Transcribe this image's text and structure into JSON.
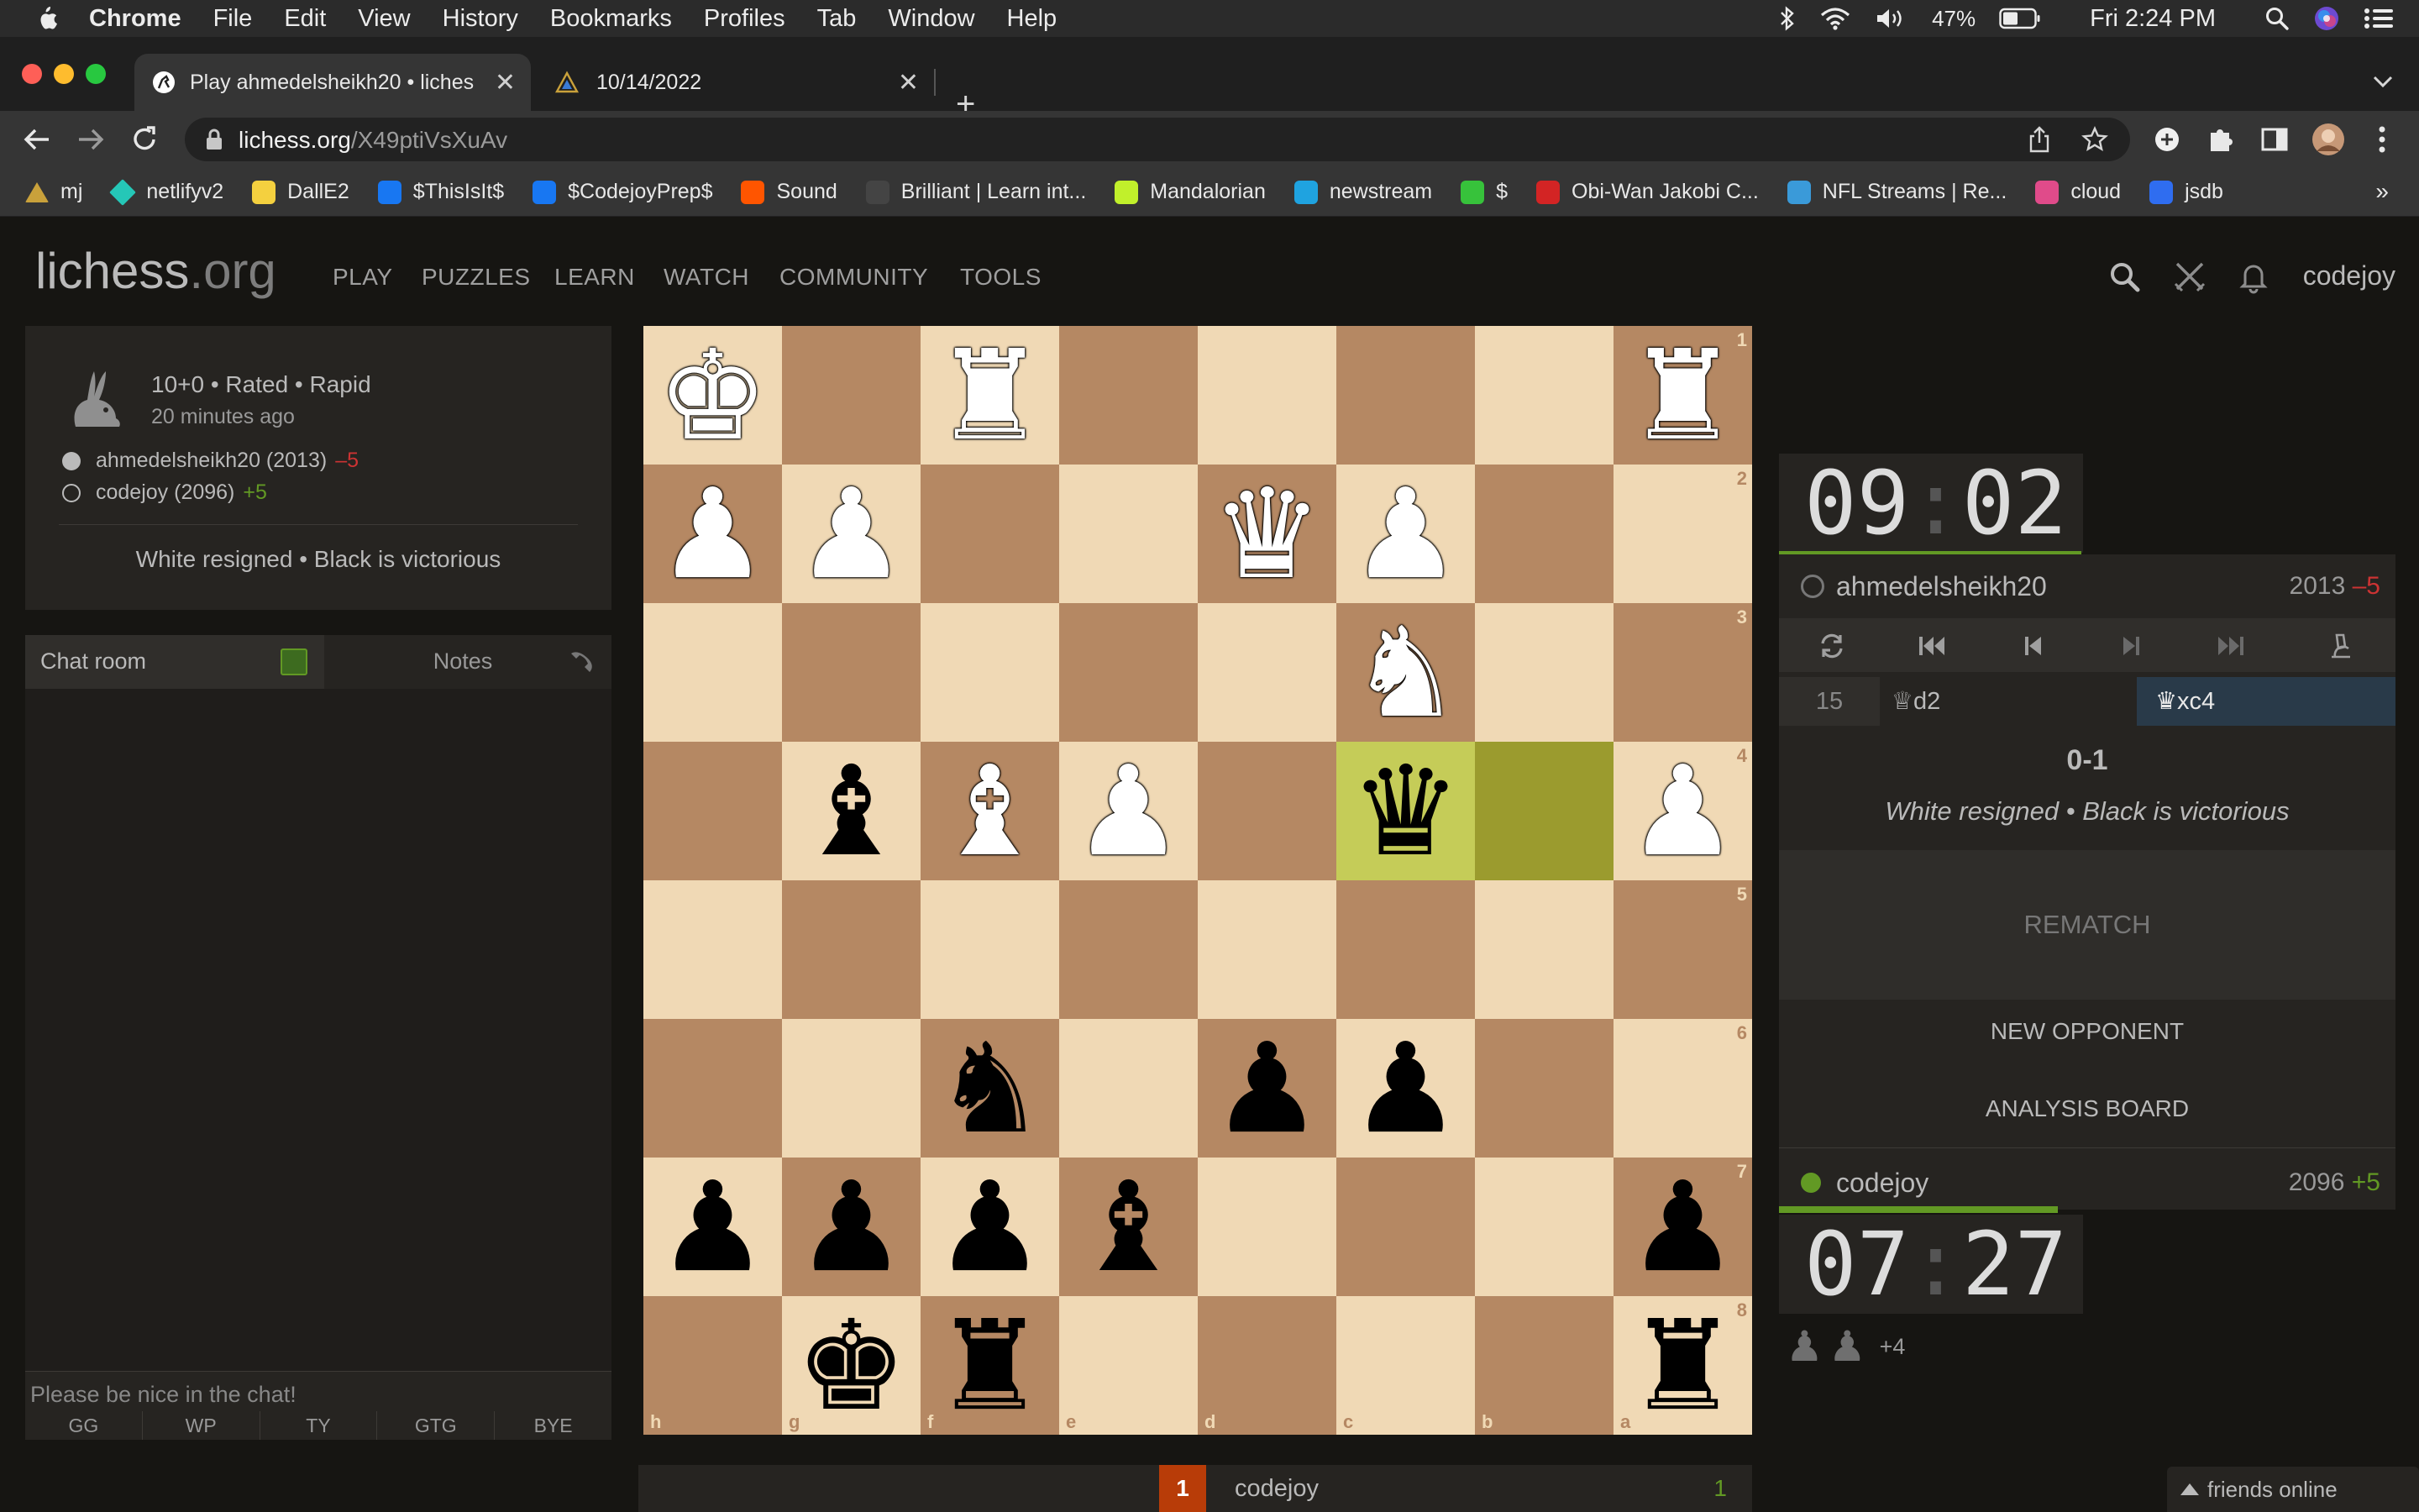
{
  "menubar": {
    "app": "Chrome",
    "items": [
      "File",
      "Edit",
      "View",
      "History",
      "Bookmarks",
      "Profiles",
      "Tab",
      "Window",
      "Help"
    ],
    "battery": "47%",
    "clock": "Fri 2:24 PM"
  },
  "tabs": [
    {
      "title": "Play ahmedelsheikh20 • liches",
      "active": true
    },
    {
      "title": "10/14/2022",
      "active": false
    }
  ],
  "address": {
    "host": "lichess.org",
    "path": "/X49ptiVsXuAv"
  },
  "bookmarks": [
    {
      "label": "mj",
      "icon": "triangle-icon",
      "color": "#c9a13b"
    },
    {
      "label": "netlifyv2",
      "icon": "diamond-icon",
      "color": "#25c7b7"
    },
    {
      "label": "DallE2",
      "icon": "stripes-icon",
      "color": "#f4d03f"
    },
    {
      "label": "$ThisIsIt$",
      "icon": "meta-icon",
      "color": "#1877f2"
    },
    {
      "label": "$CodejoyPrep$",
      "icon": "meta-icon",
      "color": "#1877f2"
    },
    {
      "label": "Sound",
      "icon": "soundcloud-icon",
      "color": "#ff5500"
    },
    {
      "label": "Brilliant | Learn int...",
      "icon": "brilliant-icon",
      "color": "#444444"
    },
    {
      "label": "Mandalorian",
      "icon": "f-icon",
      "color": "#c1f02b"
    },
    {
      "label": "newstream",
      "icon": "play-icon",
      "color": "#1fa3e0"
    },
    {
      "label": "$",
      "icon": "leaf-icon",
      "color": "#37c23b"
    },
    {
      "label": "Obi-Wan Jakobi C...",
      "icon": "bars-icon",
      "color": "#d32424"
    },
    {
      "label": "NFL Streams | Re...",
      "icon": "image-icon",
      "color": "#3a9ad9"
    },
    {
      "label": "cloud",
      "icon": "cloud-icon",
      "color": "#e04b8a"
    },
    {
      "label": "jsdb",
      "icon": "dropbox-icon",
      "color": "#2f6df0"
    }
  ],
  "site": {
    "logo": "lichess",
    "logo_tld": ".org",
    "nav": [
      "PLAY",
      "PUZZLES",
      "LEARN",
      "WATCH",
      "COMMUNITY",
      "TOOLS"
    ],
    "user": "codejoy"
  },
  "game": {
    "meta": "10+0 • Rated • Rapid",
    "time_ago": "20 minutes ago",
    "white": {
      "name": "ahmedelsheikh20 (2013)",
      "diff": "–5"
    },
    "black": {
      "name": "codejoy (2096)",
      "diff": "+5"
    },
    "status": "White resigned • Black is victorious"
  },
  "chat": {
    "tab_chat": "Chat room",
    "tab_notes": "Notes",
    "placeholder": "Please be nice in the chat!",
    "presets": [
      "GG",
      "WP",
      "TY",
      "GTG",
      "BYE"
    ]
  },
  "board": {
    "ranks": [
      "1",
      "2",
      "3",
      "4",
      "5",
      "6",
      "7",
      "8"
    ],
    "files": [
      "h",
      "g",
      "f",
      "e",
      "d",
      "c",
      "b",
      "a"
    ],
    "last_move": {
      "from": "b4",
      "to": "c4"
    },
    "position": [
      [
        "wK",
        "",
        "wR",
        "",
        "",
        "",
        "",
        "wR"
      ],
      [
        "wP",
        "wP",
        "",
        "",
        "wQ",
        "wP",
        "",
        ""
      ],
      [
        "",
        "",
        "",
        "",
        "",
        "wN",
        "",
        ""
      ],
      [
        "",
        "bB",
        "wB",
        "wP",
        "",
        "bQ",
        "",
        "wP"
      ],
      [
        "",
        "",
        "",
        "",
        "",
        "",
        "",
        ""
      ],
      [
        "",
        "",
        "bN",
        "",
        "bP",
        "bP",
        "",
        ""
      ],
      [
        "bP",
        "bP",
        "bP",
        "bB",
        "",
        "",
        "",
        "bP"
      ],
      [
        "",
        "bK",
        "bR",
        "",
        "",
        "",
        "",
        "bR"
      ]
    ]
  },
  "under_board": {
    "rank": "1",
    "name": "codejoy",
    "score": "1"
  },
  "top_clock": {
    "min": "09",
    "sec": "02",
    "bar_fraction": 0.9
  },
  "bottom_clock": {
    "min": "07",
    "sec": "27",
    "bar_fraction": 0.73
  },
  "opponent": {
    "name": "ahmedelsheikh20",
    "rating": "2013",
    "diff": "–5"
  },
  "me": {
    "name": "codejoy",
    "rating": "2096",
    "diff": "+5"
  },
  "moves": {
    "number": "15",
    "white": "♕d2",
    "black": "♛xc4"
  },
  "result": {
    "score": "0-1",
    "status": "White resigned • Black is victorious"
  },
  "buttons": {
    "rematch": "REMATCH",
    "new_opponent": "NEW OPPONENT",
    "analysis": "ANALYSIS BOARD"
  },
  "captured": {
    "pieces": [
      "♟",
      "♟"
    ],
    "advantage": "+4"
  },
  "friends": "friends online"
}
